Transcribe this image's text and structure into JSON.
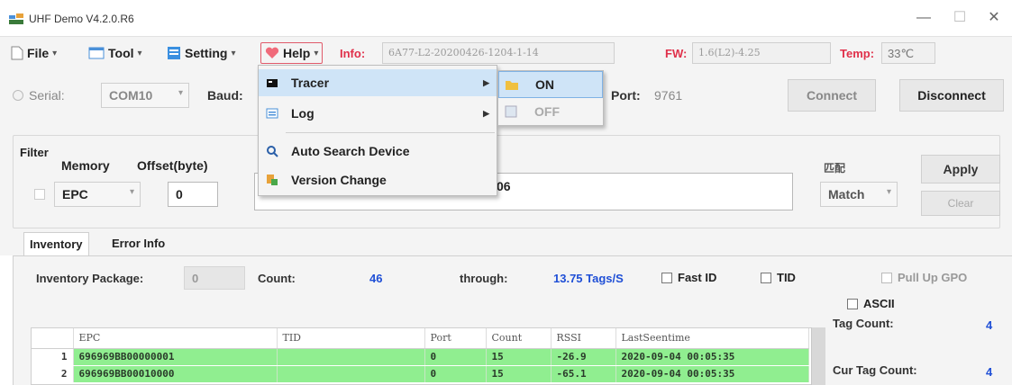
{
  "window": {
    "title": "UHF Demo V4.2.0.R6",
    "minimize_glyph": "—",
    "maximize_glyph": "☐",
    "close_glyph": "✕"
  },
  "menubar": {
    "file": "File",
    "tool": "Tool",
    "setting": "Setting",
    "help": "Help",
    "caret": "▾",
    "info_label": "Info:",
    "info_value": "6A77-L2-20200426-1204-1-14",
    "fw_label": "FW:",
    "fw_value": "1.6(L2)-4.25",
    "temp_label": "Temp:",
    "temp_value": "33℃"
  },
  "connection": {
    "serial_label": "Serial:",
    "port_value": "COM10",
    "baud_label": "Baud:",
    "port_label": "Port:",
    "port_number": "9761",
    "connect_label": "Connect",
    "disconnect_label": "Disconnect"
  },
  "filter": {
    "title": "Filter",
    "memory_label": "Memory",
    "offset_label": "Offset(byte)",
    "memory_value": "EPC",
    "offset_value": "0",
    "data_value": "06",
    "match_header": "匹配",
    "match_value": "Match",
    "apply_label": "Apply",
    "clear_label": "Clear"
  },
  "tabs": [
    {
      "label": "Inventory",
      "active": true
    },
    {
      "label": "Error Info",
      "active": false
    }
  ],
  "inventory": {
    "package_label": "Inventory Package:",
    "package_value": "0",
    "count_label": "Count:",
    "count_value": "46",
    "through_label": "through:",
    "through_value": "13.75 Tags/S",
    "fast_id_label": "Fast ID",
    "tid_label": "TID",
    "pull_up_label": "Pull Up GPO",
    "ascii_label": "ASCII",
    "tag_count_label": "Tag Count:",
    "tag_count_value": "4",
    "cur_tag_count_label": "Cur Tag Count:",
    "cur_tag_count_value": "4"
  },
  "grid": {
    "columns": [
      "EPC",
      "TID",
      "Port",
      "Count",
      "RSSI",
      "LastSeentime"
    ],
    "rows": [
      {
        "num": "1",
        "epc": "696969BB00000001",
        "tid": "",
        "port": "0",
        "count": "15",
        "rssi": "-26.9",
        "time": "2020-09-04 00:05:35"
      },
      {
        "num": "2",
        "epc": "696969BB00010000",
        "tid": "",
        "port": "0",
        "count": "15",
        "rssi": "-65.1",
        "time": "2020-09-04 00:05:35"
      }
    ],
    "row_color": "#90ee90"
  },
  "help_menu": {
    "items": [
      {
        "label": "Tracer",
        "icon": "tracer-icon",
        "has_submenu": true
      },
      {
        "label": "Log",
        "icon": "log-icon",
        "has_submenu": true
      },
      {
        "label": "Auto Search Device",
        "icon": "search-device-icon",
        "has_submenu": false
      },
      {
        "label": "Version Change",
        "icon": "version-change-icon",
        "has_submenu": false
      }
    ],
    "submenu_arrow": "▶"
  },
  "tracer_submenu": {
    "on_label": "ON",
    "off_label": "OFF"
  },
  "colors": {
    "accent_red": "#e0304a",
    "value_blue": "#1f4fd6",
    "highlight": "#cfe4f7",
    "row_green": "#90ee90"
  }
}
